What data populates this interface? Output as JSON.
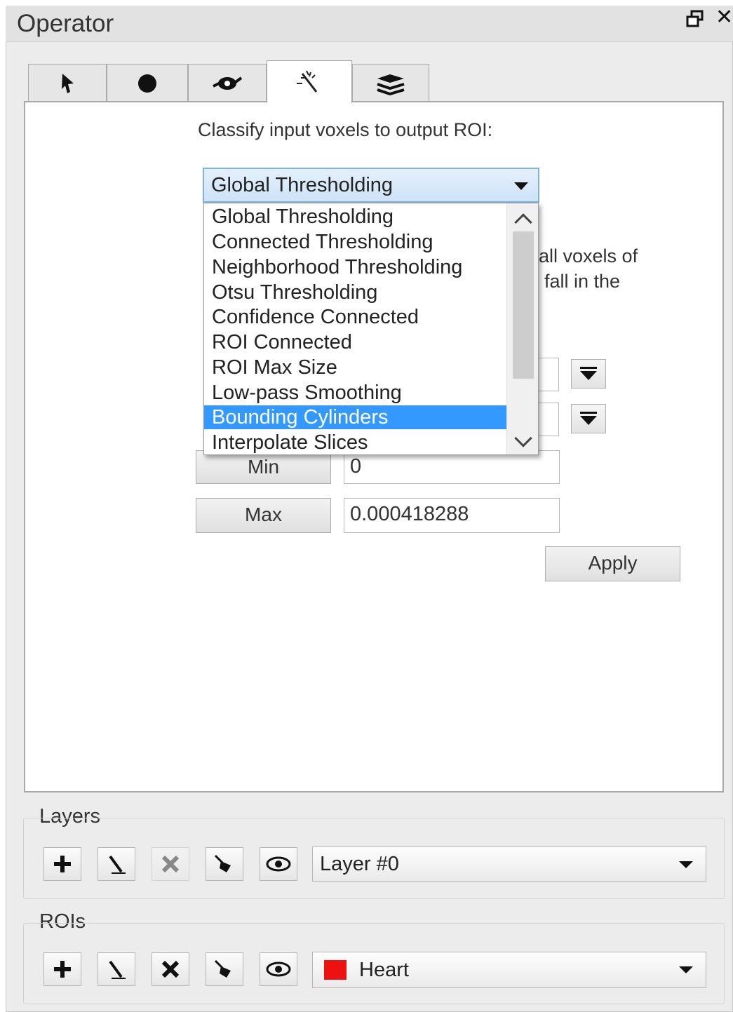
{
  "window": {
    "title": "Operator",
    "float_icon": "float-icon",
    "close_glyph": "✕"
  },
  "tabs": [
    {
      "icon": "pointer-icon",
      "active": false
    },
    {
      "icon": "brush-icon",
      "active": false
    },
    {
      "icon": "seed-icon",
      "active": false
    },
    {
      "icon": "magic-wand-icon",
      "active": true
    },
    {
      "icon": "layers-stack-icon",
      "active": false
    }
  ],
  "operator": {
    "classify_label": "Classify input voxels to output ROI:",
    "combo_value": "Global Thresholding",
    "dropdown_options": [
      "Global Thresholding",
      "Connected Thresholding",
      "Neighborhood Thresholding",
      "Otsu Thresholding",
      "Confidence Connected",
      "ROI Connected",
      "ROI Max Size",
      "Low-pass Smoothing",
      "Bounding Cylinders",
      "Interpolate Slices"
    ],
    "highlighted_option": "Bounding Cylinders",
    "description_fragment_1": "all voxels of",
    "description_fragment_2": "fall in the",
    "min_label": "Min",
    "min_value": "0",
    "max_label": "Max",
    "max_value": "0.000418288",
    "apply_label": "Apply"
  },
  "layers": {
    "label": "Layers",
    "tools": [
      "add-icon",
      "edit-icon",
      "delete-icon",
      "fill-icon",
      "visibility-icon"
    ],
    "selected": "Layer #0"
  },
  "rois": {
    "label": "ROIs",
    "tools": [
      "add-icon",
      "edit-icon",
      "delete-icon",
      "fill-icon",
      "visibility-icon"
    ],
    "selected": "Heart",
    "color": "#ee1111"
  },
  "colors": {
    "selection": "#3399ff",
    "combo_border": "#7fb2e6"
  }
}
